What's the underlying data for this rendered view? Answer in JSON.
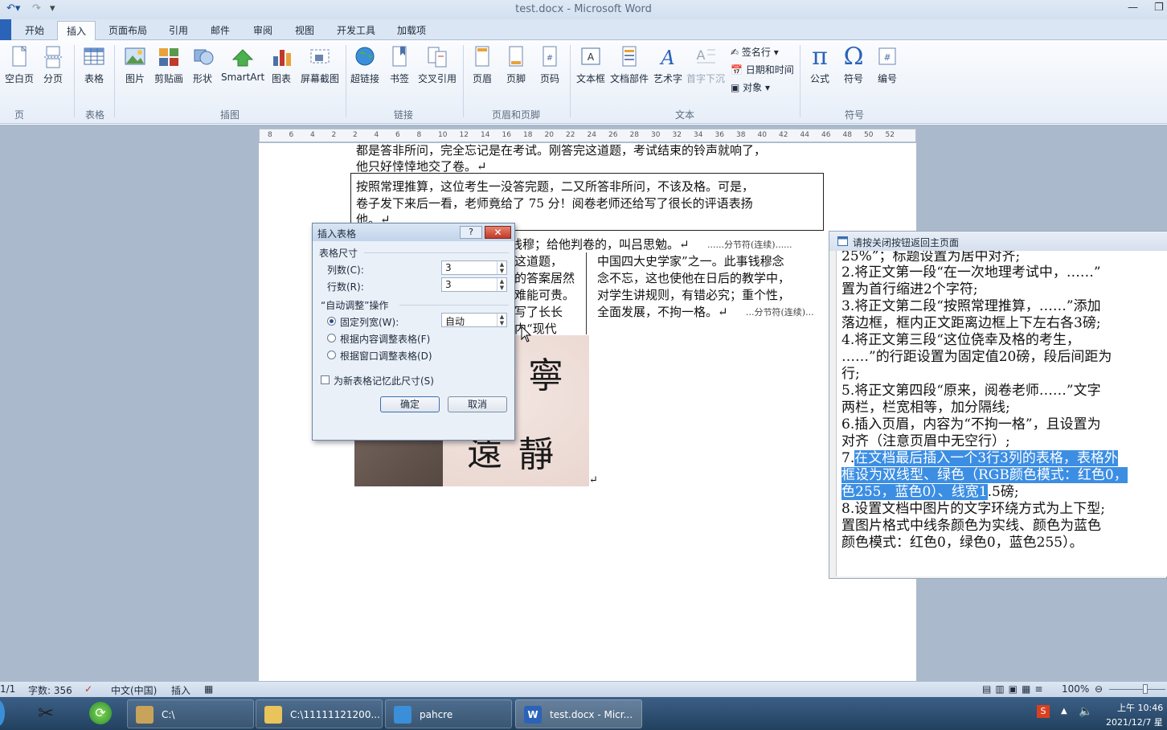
{
  "window": {
    "title": "test.docx - Microsoft Word"
  },
  "ribbon_tabs": [
    "开始",
    "插入",
    "页面布局",
    "引用",
    "邮件",
    "审阅",
    "视图",
    "开发工具",
    "加载项"
  ],
  "ribbon": {
    "buttons": {
      "blank_page": "空白页",
      "page_break": "分页",
      "table": "表格",
      "picture": "图片",
      "clipart": "剪贴画",
      "shapes": "形状",
      "smartart": "SmartArt",
      "chart": "图表",
      "screenshot": "屏幕截图",
      "hyperlink": "超链接",
      "bookmark": "书签",
      "crossref": "交叉引用",
      "header": "页眉",
      "footer": "页脚",
      "page_number": "页码",
      "textbox": "文本框",
      "quickparts": "文档部件",
      "wordart": "艺术字",
      "dropcap": "首字下沉",
      "signature": "签名行",
      "datetime": "日期和时间",
      "object": "对象",
      "equation": "公式",
      "symbol": "符号",
      "number": "编号"
    },
    "groups": {
      "pages": "页",
      "tables": "表格",
      "illustrations": "插图",
      "links": "链接",
      "header_footer": "页眉和页脚",
      "text": "文本",
      "symbols": "符号"
    }
  },
  "ruler_marks": [
    "8",
    "6",
    "4",
    "2",
    "2",
    "4",
    "6",
    "8",
    "10",
    "12",
    "14",
    "16",
    "18",
    "20",
    "22",
    "24",
    "26",
    "28",
    "30",
    "32",
    "34",
    "36",
    "38",
    "40",
    "42",
    "44",
    "46",
    "48",
    "50",
    "52"
  ],
  "document": {
    "line1": "都是答非所问，完全忘记是在考试。刚答完这道题，考试结束的铃声就响了，",
    "line2": "他只好悻悻地交了卷。↵",
    "box_line1": "按照常理推算，这位考生一没答完题，二又所答非所问，不该及格。可是，",
    "box_line2": "卷子发下来后一看，老师竟给了 75 分！阅卷老师还给写了很长的评语表扬",
    "box_line3": "他。↵",
    "line_after_box": "钱穆；给他判卷的，叫吕思勉。↵",
    "section_break": "分节符(连续)",
    "left_col": [
      "这道题，",
      "的答案居然",
      "难能可贵。",
      "写了长长",
      "内“现代"
    ],
    "right_col": [
      "中国四大史学家”之一。此事钱穆念",
      "念不忘，这也使他在日后的教学中，",
      "对学生讲规则，有错必究；重个性，",
      "全面发展，不拘一格。↵"
    ],
    "image_chars": [
      "寧",
      "遠",
      "靜"
    ]
  },
  "dialog": {
    "title": "插入表格",
    "help": "?",
    "close": "✕",
    "section_size": "表格尺寸",
    "columns_label": "列数(C):",
    "columns_value": "3",
    "rows_label": "行数(R):",
    "rows_value": "3",
    "section_autofit": "“自动调整”操作",
    "fixed_width_label": "固定列宽(W):",
    "fixed_width_value": "自动",
    "autofit_content": "根据内容调整表格(F)",
    "autofit_window": "根据窗口调整表格(D)",
    "remember": "为新表格记忆此尺寸(S)",
    "ok": "确定",
    "cancel": "取消"
  },
  "panel": {
    "title": "请按关闭按钮返回主页面",
    "lines": [
      "25%”；标题设置为居中对齐;",
      "2.将正文第一段“在一次地理考试中，……”",
      "置为首行缩进2个字符;",
      "3.将正文第二段“按照常理推算，……”添加",
      "落边框，框内正文距离边框上下左右各3磅;",
      "4.将正文第三段“这位侥幸及格的考生，",
      "……”的行距设置为固定值20磅，段后间距为",
      "行;",
      "5.将正文第四段“原来，阅卷老师……”文字",
      "两栏，栏宽相等，加分隔线;",
      "6.插入页眉，内容为“不拘一格”，且设置为",
      "对齐（注意页眉中无空行）;"
    ],
    "item7_prefix": "7.",
    "item7_hl1": "在文档最后插入一个3行3列的表格，表格外",
    "item7_hl2": "框设为双线型、绿色（RGB颜色模式：红色0，",
    "item7_hl3": "色255，蓝色0）、线宽1",
    "item7_rest": ".5磅;",
    "item8_l1": "8.设置文档中图片的文字环绕方式为上下型;",
    "item8_l2": "置图片格式中线条颜色为实线、颜色为蓝色",
    "item8_l3": "颜色模式：红色0，绿色0，蓝色255）。"
  },
  "statusbar": {
    "page": "1/1",
    "words": "字数: 356",
    "language": "中文(中国)",
    "mode": "插入",
    "zoom": "100%"
  },
  "taskbar": {
    "items": [
      "C:\\",
      "C:\\11111121200...",
      "pahcre",
      "test.docx - Micr..."
    ],
    "clock_time": "上午 10:46",
    "clock_date": "2021/12/7 星"
  },
  "colors": {
    "accent": "#2a63b8",
    "highlight": "#3c8ee3",
    "taskbar": "#2b4b6e"
  }
}
